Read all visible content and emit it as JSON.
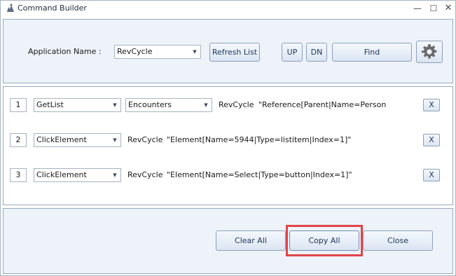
{
  "window": {
    "title": "Command Builder",
    "minimize_glyph": "—",
    "maximize_glyph": "☐",
    "close_glyph": "✕"
  },
  "toolbar": {
    "app_name_label": "Application Name :",
    "app_name_value": "RevCycle",
    "refresh_label": "Refresh List",
    "up_label": "UP",
    "dn_label": "DN",
    "find_label": "Find",
    "settings_icon": "gear-icon"
  },
  "commands": [
    {
      "index": "1",
      "action": "GetList",
      "target": "Encounters",
      "app": "RevCycle",
      "selector": "\"Reference[Parent|Name=Person|T",
      "remove_label": "X"
    },
    {
      "index": "2",
      "action": "ClickElement",
      "app": "RevCycle",
      "selector": "\"Element[Name=5944|Type=listitem|Index=1]\"",
      "remove_label": "X"
    },
    {
      "index": "3",
      "action": "ClickElement",
      "app": "RevCycle",
      "selector": "\"Element[Name=Select|Type=button|Index=1]\"",
      "remove_label": "X"
    }
  ],
  "footer": {
    "clear_all_label": "Clear All",
    "copy_all_label": "Copy All",
    "close_label": "Close"
  },
  "colors": {
    "highlight": "#e0444a",
    "panel": "#eef3fa"
  }
}
